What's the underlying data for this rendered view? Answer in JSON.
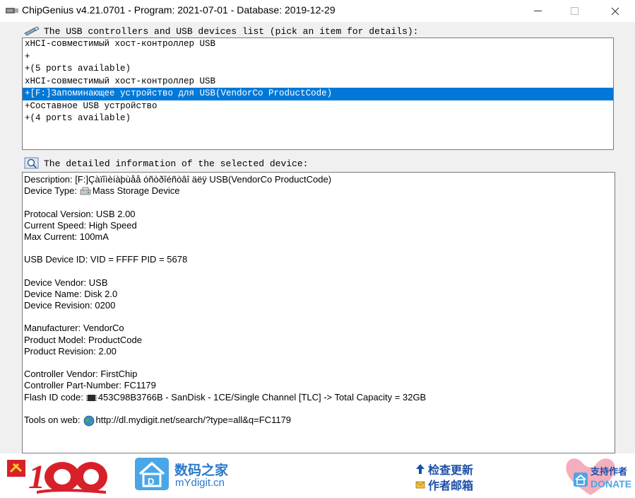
{
  "window": {
    "title": "ChipGenius v4.21.0701 - Program: 2021-07-01 - Database: 2019-12-29",
    "minimize_label": "—",
    "maximize_label": "☐",
    "close_label": "✕"
  },
  "device_section": {
    "heading": "The USB controllers and USB devices list (pick an item for details):",
    "items": [
      {
        "label": "xHCI-совместимый хост-контроллер USB",
        "selected": false
      },
      {
        "label": "+",
        "selected": false
      },
      {
        "label": "+(5 ports available)",
        "selected": false
      },
      {
        "label": "xHCI-совместимый хост-контроллер USB",
        "selected": false
      },
      {
        "label": "+[F:]Запоминающее устройство для USB(VendorCo ProductCode)",
        "selected": true
      },
      {
        "label": "+Составное USB устройство",
        "selected": false
      },
      {
        "label": "+(4 ports available)",
        "selected": false
      }
    ]
  },
  "details_section": {
    "heading": "The detailed information of the selected device:",
    "description": "Description: [F:]Çàïîìèíàþùåå óñòðîéñòâî äëÿ USB(VendorCo ProductCode)",
    "device_type_label": "Device Type:",
    "device_type_value": "Mass Storage Device",
    "protocol_version": "Protocal Version: USB 2.00",
    "current_speed": "Current Speed: High Speed",
    "max_current": "Max Current: 100mA",
    "usb_device_id": "USB Device ID: VID = FFFF PID = 5678",
    "device_vendor": "Device Vendor: USB",
    "device_name": "Device Name: Disk 2.0",
    "device_revision": "Device Revision: 0200",
    "manufacturer": "Manufacturer: VendorCo",
    "product_model": "Product Model: ProductCode",
    "product_revision": "Product Revision: 2.00",
    "controller_vendor": "Controller Vendor: FirstChip",
    "controller_part": "Controller Part-Number: FC1179",
    "flash_id_label": "Flash ID code:",
    "flash_id_value": "453C98B3766B - SanDisk - 1CE/Single Channel [TLC] -> Total Capacity = 32GB",
    "tools_label": "Tools on web:",
    "tools_url": "http://dl.mydigit.net/search/?type=all&q=FC1179"
  },
  "banner": {
    "mydigit_cn": "数码之家",
    "mydigit_en": "mYdigit.cn",
    "check_update": "检查更新",
    "author_mail": "作者邮箱",
    "donate_cn": "支持作者",
    "donate_en": "DONATE"
  },
  "colors": {
    "selection": "#0078d7",
    "window_bg": "#f0f0f0",
    "link_blue": "#2a78c8",
    "logo_red": "#d8202a"
  }
}
